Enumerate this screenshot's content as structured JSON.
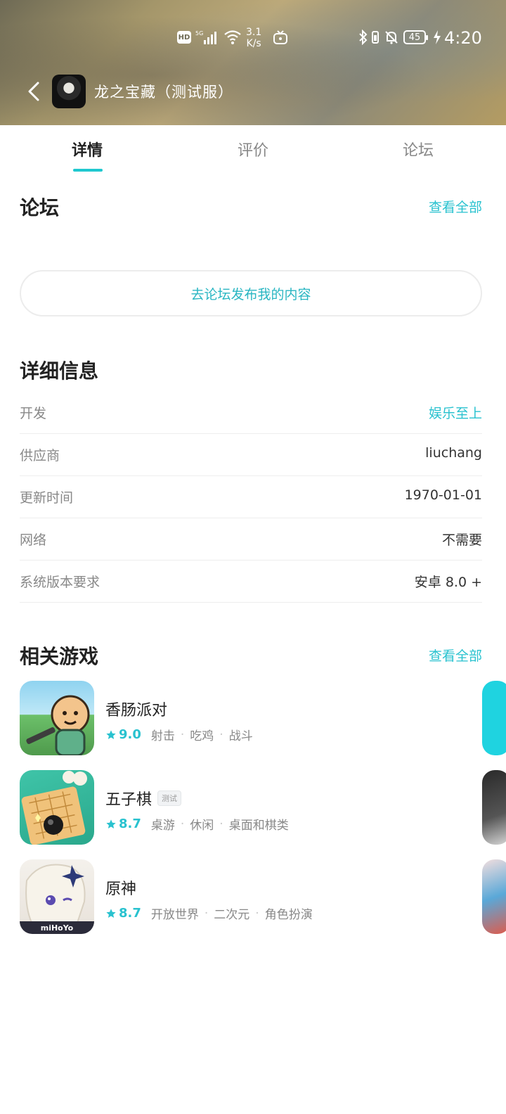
{
  "status_bar": {
    "hd": "HD",
    "net_speed_value": "3.1",
    "net_speed_unit": "K/s",
    "battery": "45",
    "time": "4:20"
  },
  "app_bar": {
    "title": "龙之宝藏（测试服）"
  },
  "tabs": [
    {
      "label": "详情"
    },
    {
      "label": "评价"
    },
    {
      "label": "论坛"
    }
  ],
  "forum": {
    "title": "论坛",
    "see_all": "查看全部",
    "post_button": "去论坛发布我的内容"
  },
  "details": {
    "title": "详细信息",
    "rows": [
      {
        "label": "开发",
        "value": "娱乐至上"
      },
      {
        "label": "供应商",
        "value": "liuchang"
      },
      {
        "label": "更新时间",
        "value": "1970-01-01"
      },
      {
        "label": "网络",
        "value": "不需要"
      },
      {
        "label": "系统版本要求",
        "value": "安卓 8.0 +"
      }
    ]
  },
  "related": {
    "title": "相关游戏",
    "see_all": "查看全部",
    "games": [
      {
        "name": "香肠派对",
        "badge": "",
        "rating": "9.0",
        "tags": [
          "射击",
          "吃鸡",
          "战斗"
        ]
      },
      {
        "name": "五子棋",
        "badge": "测试",
        "rating": "8.7",
        "tags": [
          "桌游",
          "休闲",
          "桌面和棋类"
        ]
      },
      {
        "name": "原神",
        "badge": "",
        "rating": "8.7",
        "tags": [
          "开放世界",
          "二次元",
          "角色扮演"
        ],
        "icon_text": "miHoYo"
      }
    ]
  },
  "colors": {
    "accent": "#29c2cf",
    "tab_indicator": "#1fc8cf"
  }
}
